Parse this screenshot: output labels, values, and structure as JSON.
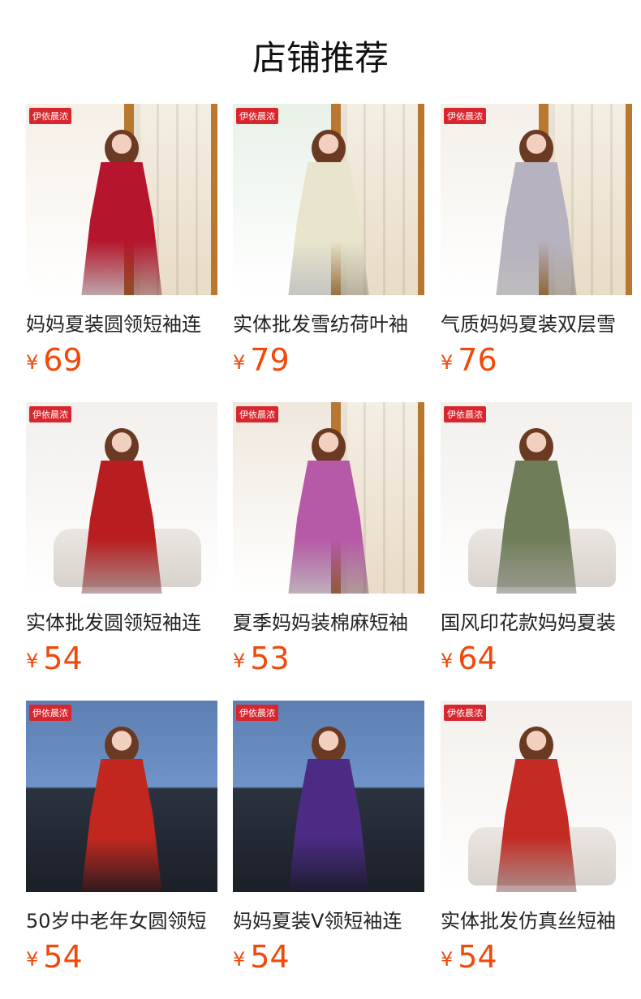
{
  "title": "店铺推荐",
  "brand_tag": "伊依晨浓",
  "currency_symbol": "¥",
  "products": [
    {
      "name": "妈妈夏装圆领短袖连",
      "price": "69",
      "bg": "#f6efe6",
      "dress": "#b5162d",
      "scene": "door"
    },
    {
      "name": "实体批发雪纺荷叶袖",
      "price": "79",
      "bg": "#e8f1e8",
      "dress": "#e9e5cd",
      "scene": "door"
    },
    {
      "name": "气质妈妈夏装双层雪",
      "price": "76",
      "bg": "#f4efe8",
      "dress": "#b7b2c0",
      "scene": "door"
    },
    {
      "name": "实体批发圆领短袖连",
      "price": "54",
      "bg": "#f2efec",
      "dress": "#b81d20",
      "scene": "sofa"
    },
    {
      "name": "夏季妈妈装棉麻短袖",
      "price": "53",
      "bg": "#efe7dc",
      "dress": "#b65aa7",
      "scene": "door"
    },
    {
      "name": "国风印花款妈妈夏装",
      "price": "64",
      "bg": "#f2efec",
      "dress": "#6f7d58",
      "scene": "sofa"
    },
    {
      "name": "50岁中老年女圆领短",
      "price": "54",
      "bg": "#5d7fb1",
      "dress": "#c2271f",
      "scene": "dark"
    },
    {
      "name": "妈妈夏装V领短袖连",
      "price": "54",
      "bg": "#5d7fb1",
      "dress": "#4b2b84",
      "scene": "dark"
    },
    {
      "name": "实体批发仿真丝短袖",
      "price": "54",
      "bg": "#f4efeb",
      "dress": "#c32b24",
      "scene": "sofa"
    }
  ]
}
